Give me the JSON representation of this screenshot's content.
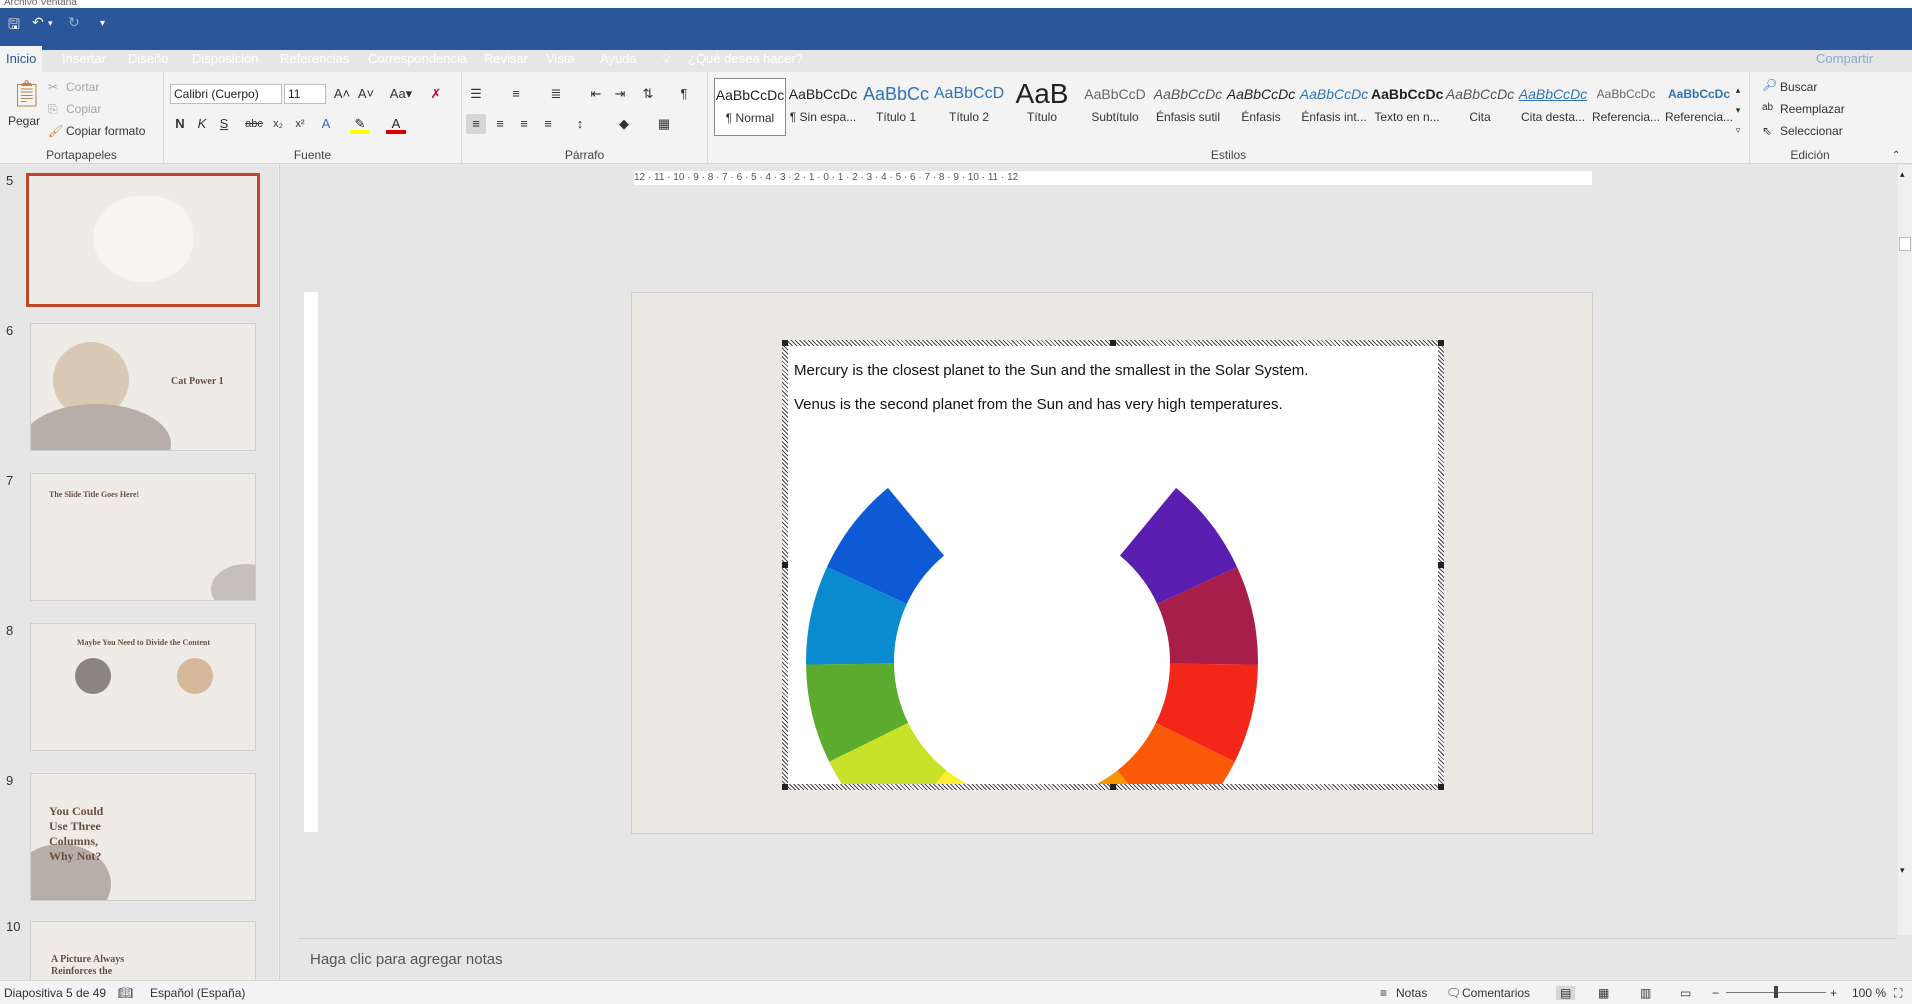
{
  "window": {
    "top_menu": "Archivo   Ventana"
  },
  "tabs": [
    "Inicio",
    "Insertar",
    "Diseño",
    "Disposición",
    "Referencias",
    "Correspondencia",
    "Revisar",
    "Vista",
    "Ayuda"
  ],
  "tell_me": "¿Qué desea hacer?",
  "share": "Compartir",
  "clipboard": {
    "paste": "Pegar",
    "cut": "Cortar",
    "copy": "Copiar",
    "format_painter": "Copiar formato",
    "label": "Portapapeles"
  },
  "font": {
    "name": "Calibri (Cuerpo)",
    "size": "11",
    "label": "Fuente"
  },
  "paragraph": {
    "label": "Párrafo"
  },
  "styles": {
    "label": "Estilos",
    "items": [
      {
        "preview": "AaBbCcDc",
        "name": "¶ Normal"
      },
      {
        "preview": "AaBbCcDc",
        "name": "¶ Sin espa..."
      },
      {
        "preview": "AaBbCc",
        "name": "Título 1"
      },
      {
        "preview": "AaBbCcD",
        "name": "Título 2"
      },
      {
        "preview": "AaB",
        "name": "Título"
      },
      {
        "preview": "AaBbCcD",
        "name": "Subtítulo"
      },
      {
        "preview": "AaBbCcDc",
        "name": "Énfasis sutil"
      },
      {
        "preview": "AaBbCcDc",
        "name": "Énfasis"
      },
      {
        "preview": "AaBbCcDc",
        "name": "Énfasis int..."
      },
      {
        "preview": "AaBbCcDc",
        "name": "Texto en n..."
      },
      {
        "preview": "AaBbCcDc",
        "name": "Cita"
      },
      {
        "preview": "AaBbCcDc",
        "name": "Cita desta..."
      },
      {
        "preview": "AaBbCcDc",
        "name": "Referencia..."
      },
      {
        "preview": "AaBbCcDc",
        "name": "Referencia..."
      }
    ]
  },
  "editing": {
    "find": "Buscar",
    "replace": "Reemplazar",
    "select": "Seleccionar",
    "label": "Edición"
  },
  "thumbnails": [
    {
      "num": "5",
      "title": ""
    },
    {
      "num": "6",
      "title": "Cat Power 1"
    },
    {
      "num": "7",
      "title": "The Slide Title Goes Here!"
    },
    {
      "num": "8",
      "title": "Maybe You Need to Divide the Content"
    },
    {
      "num": "9",
      "title": "You Could Use Three Columns, Why Not?"
    },
    {
      "num": "10",
      "title": "A Picture Always Reinforces the"
    }
  ],
  "ruler_labels": "12 · 11 · 10 · 9 · 8 · 7 · 6 · 5 · 4 · 3 · 2 · 1 · 0 · 1 · 2 · 3 · 4 · 5 · 6 · 7 · 8 · 9 · 10 · 11 · 12",
  "document": {
    "line1": "Mercury is the closest planet to the Sun and the smallest in the Solar System.",
    "line2": "Venus is the second planet from the Sun and has very high temperatures."
  },
  "wheel_colors": [
    "#0d5ad4",
    "#0a8bd0",
    "#5aab2e",
    "#c8e22a",
    "#fcee31",
    "#f8c000",
    "#f89600",
    "#fa5a08",
    "#f3261a",
    "#a81e4a",
    "#5a1eb0"
  ],
  "notes_placeholder": "Haga clic para agregar notas",
  "status": {
    "slide": "Diapositiva 5 de 49",
    "language": "Español (España)",
    "notes": "Notas",
    "comments": "Comentarios",
    "zoom": "100 %"
  }
}
